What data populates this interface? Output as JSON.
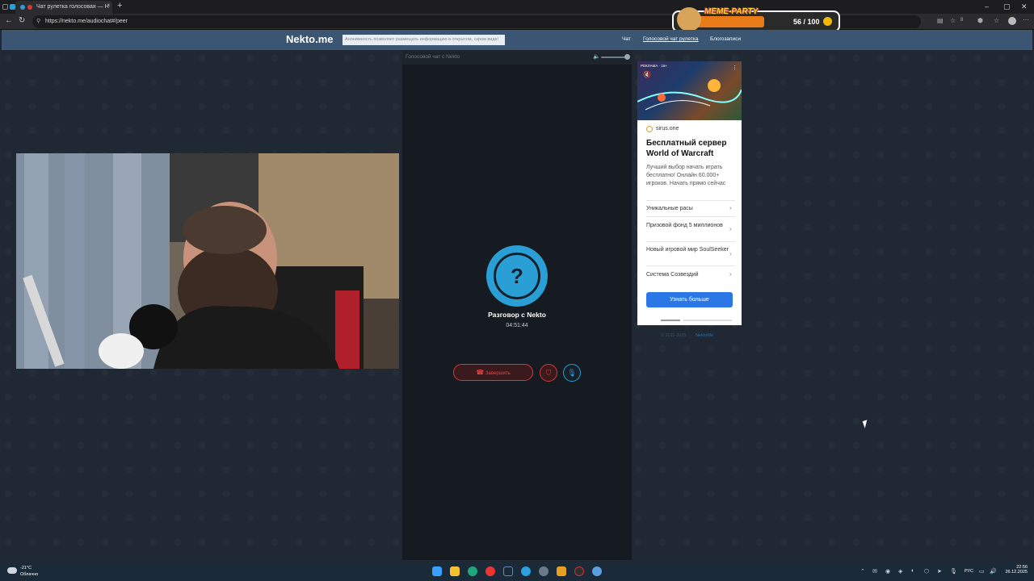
{
  "browser": {
    "tab_title": "Чат рулетка голосовая — Н",
    "url": "https://nekto.me/audiochat#/peer",
    "new_tab": "+",
    "extension_count": "8"
  },
  "meme_party": {
    "title": "MEME-PARTY",
    "score": "56 / 100"
  },
  "site": {
    "logo": "Nekto.me",
    "notice": "Анонимность позволяет размещать информацию в открытом, скром виде!",
    "nav": [
      "Чат",
      "Голосовой чат рулетка",
      "Блогозаписи"
    ]
  },
  "chat": {
    "panel_title": "Голосовой чат с Nekto",
    "avatar_symbol": "?",
    "conversation_title": "Разговор с Nekto",
    "timer": "04:51:44",
    "end_button": "Завершить"
  },
  "ad": {
    "label": "РЕКЛАМА · 16+",
    "site": "sirus.one",
    "title": "Бесплатный сервер World of Warcraft",
    "description": "Лучший выбор начать играть бесплатно! Онлайн 60.000+ игроков. Начать прямо сейчас",
    "items": [
      "Уникальные расы",
      "Призовой фонд 5 миллионов",
      "Новый игровой мир SoulSeeker",
      "Система Созвездий"
    ],
    "button": "Узнать больше"
  },
  "footer": {
    "copyright": "© 2011-2025",
    "brand": "NektoMe"
  },
  "taskbar": {
    "temperature": "-21°C",
    "weather": "Облачно",
    "language": "РУС",
    "time": "22:56",
    "date": "26.12.2025"
  },
  "colors": {
    "header": "#3b5673",
    "accent": "#2a9fd6",
    "end_call": "#d23a3a",
    "ad_button": "#2c77e6",
    "page_bg": "#1f2833"
  }
}
